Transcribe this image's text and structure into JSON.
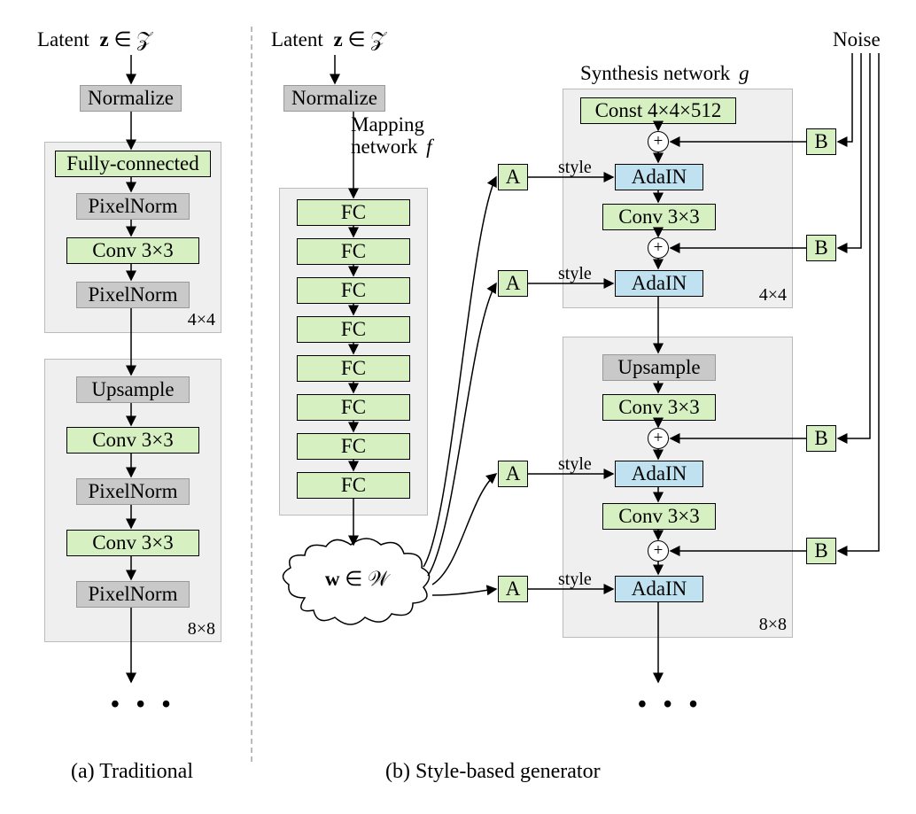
{
  "labels": {
    "latent_a": "Latent",
    "latent_b": "Latent",
    "latent_math": "z ∈ 𝒵",
    "noise": "Noise",
    "synth": "Synthesis network",
    "synth_g": "g",
    "mapping": "Mapping",
    "mapping2": "network",
    "mapping_f": "f",
    "style": "style",
    "w_math": "w ∈ 𝒲",
    "caption_a": "(a) Traditional",
    "caption_b": "(b) Style-based generator",
    "dots": "• • •",
    "res4": "4×4",
    "res8": "8×8"
  },
  "traditional": {
    "normalize": "Normalize",
    "fc": "Fully-connected",
    "pn": "PixelNorm",
    "conv": "Conv 3×3",
    "upsample": "Upsample"
  },
  "style": {
    "normalize": "Normalize",
    "fc": "FC",
    "const": "Const 4×4×512",
    "conv": "Conv 3×3",
    "adain": "AdaIN",
    "upsample": "Upsample",
    "A": "A",
    "B": "B",
    "plus": "+"
  }
}
